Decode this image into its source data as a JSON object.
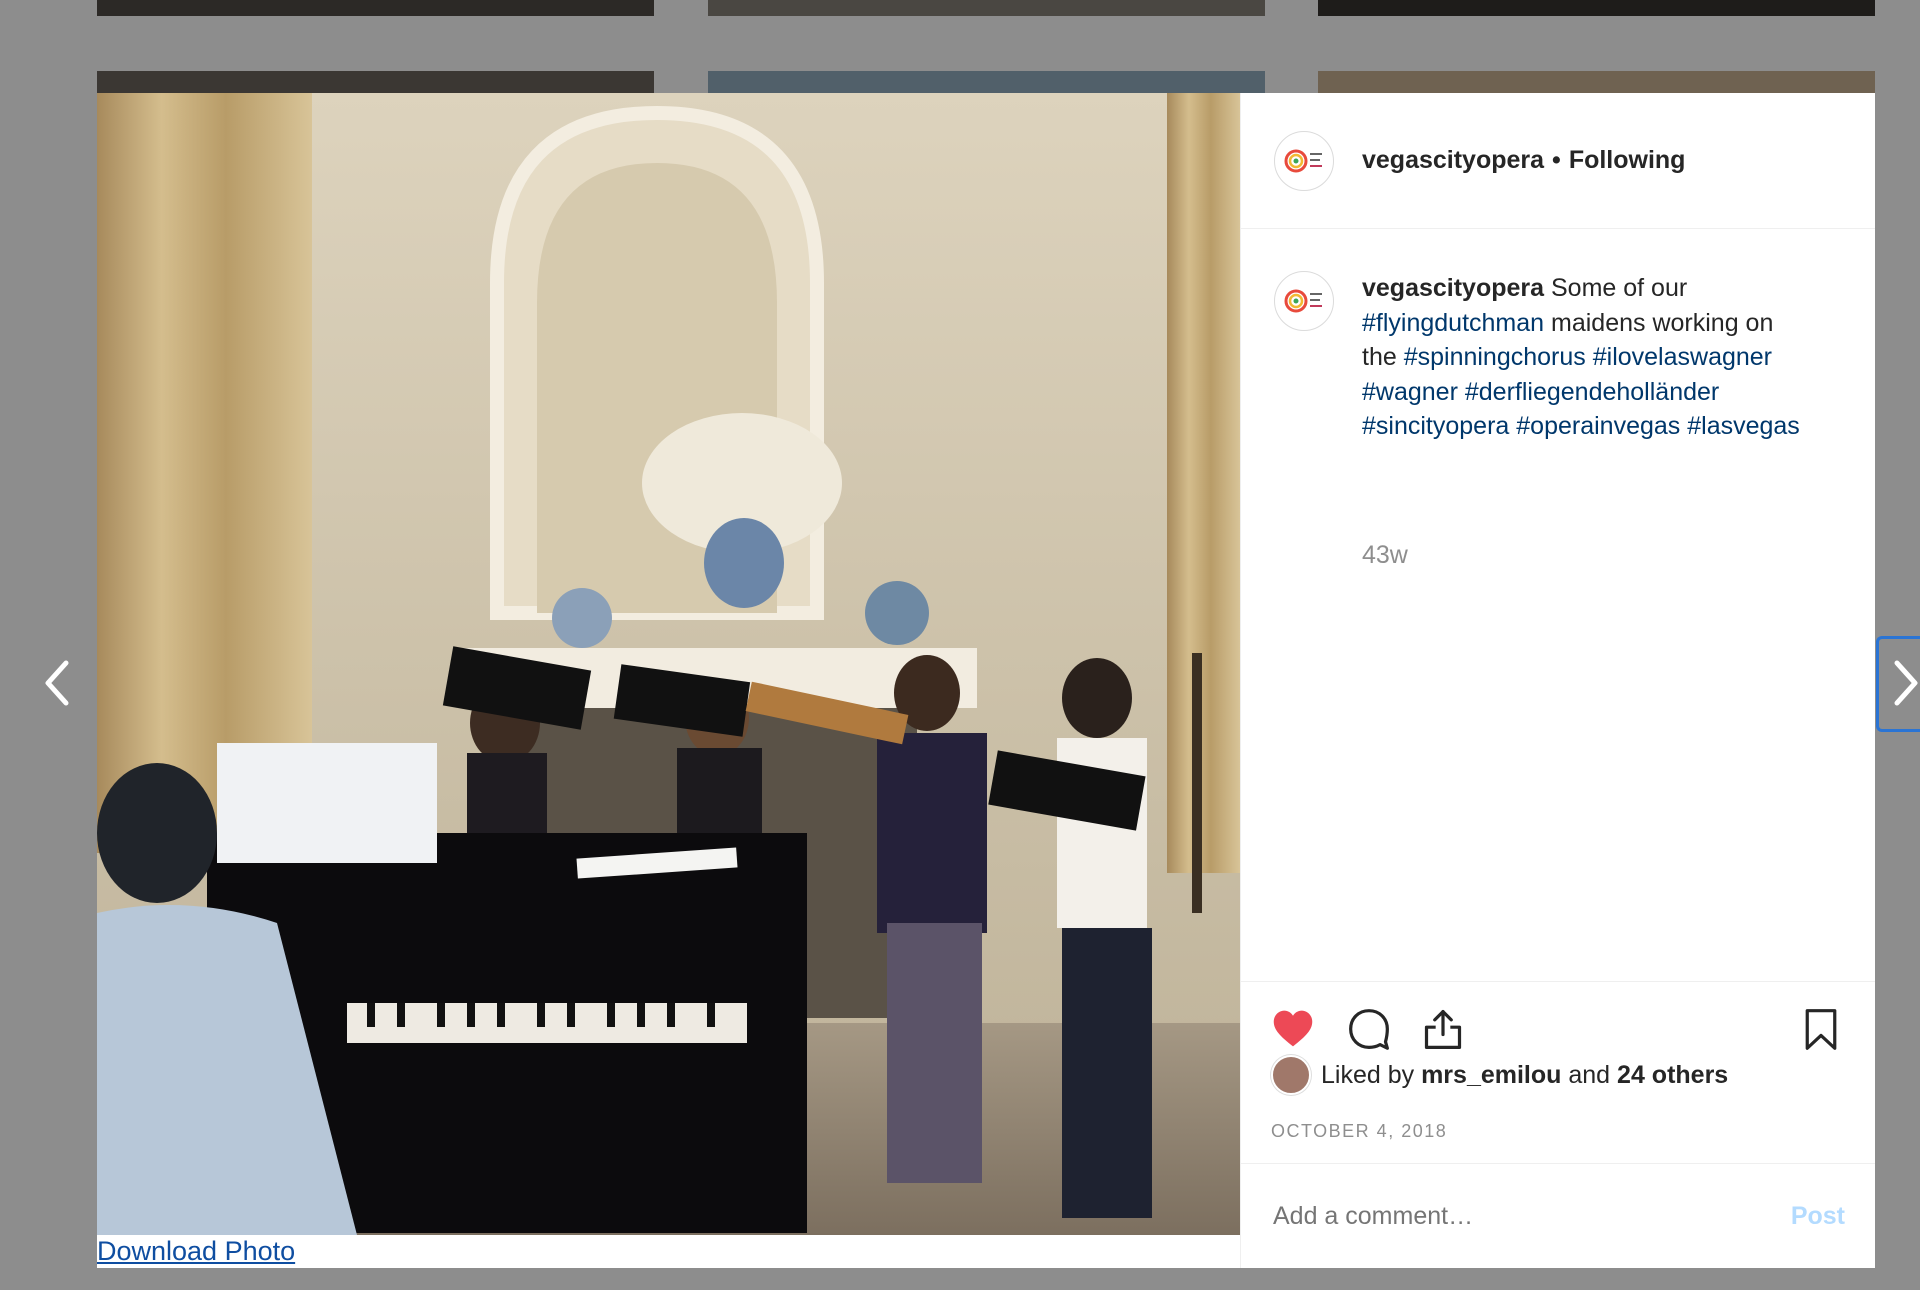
{
  "profile": {
    "username": "vegascityopera",
    "separator": "•",
    "follow_status": "Following"
  },
  "caption": {
    "username": "vegascityopera",
    "segments": [
      {
        "text": " Some of our ",
        "tag": false
      },
      {
        "text": "#flyingdutchman",
        "tag": true
      },
      {
        "text": " maidens working on the ",
        "tag": false
      },
      {
        "text": "#spinningchorus",
        "tag": true
      },
      {
        "text": " ",
        "tag": false
      },
      {
        "text": "#ilovelaswagner",
        "tag": true
      },
      {
        "text": " ",
        "tag": false
      },
      {
        "text": "#wagner",
        "tag": true
      },
      {
        "text": " ",
        "tag": false
      },
      {
        "text": "#derfliegendeholländer",
        "tag": true
      },
      {
        "text": " ",
        "tag": false
      },
      {
        "text": "#sincityopera",
        "tag": true
      },
      {
        "text": " ",
        "tag": false
      },
      {
        "text": "#operainvegas",
        "tag": true
      },
      {
        "text": " ",
        "tag": false
      },
      {
        "text": "#lasvegas",
        "tag": true
      }
    ]
  },
  "post": {
    "time_ago": "43w",
    "liked_by_prefix": "Liked by",
    "liked_by_user": "mrs_emilou",
    "liked_by_suffix": "and",
    "liked_by_others": "24 others",
    "date": "OCTOBER 4, 2018"
  },
  "comment": {
    "placeholder": "Add a comment…",
    "post_label": "Post"
  },
  "download_label": "Download Photo",
  "icons": {
    "like": "heart-filled-icon",
    "comment": "speech-bubble-icon",
    "share": "share-upload-icon",
    "save": "bookmark-icon",
    "prev": "chevron-left-icon",
    "next": "chevron-right-icon"
  },
  "colors": {
    "like_red": "#ed4956",
    "hashtag_blue": "#00376b",
    "post_disabled": "#b3dbff",
    "secondary_text": "#8e8e8e"
  }
}
